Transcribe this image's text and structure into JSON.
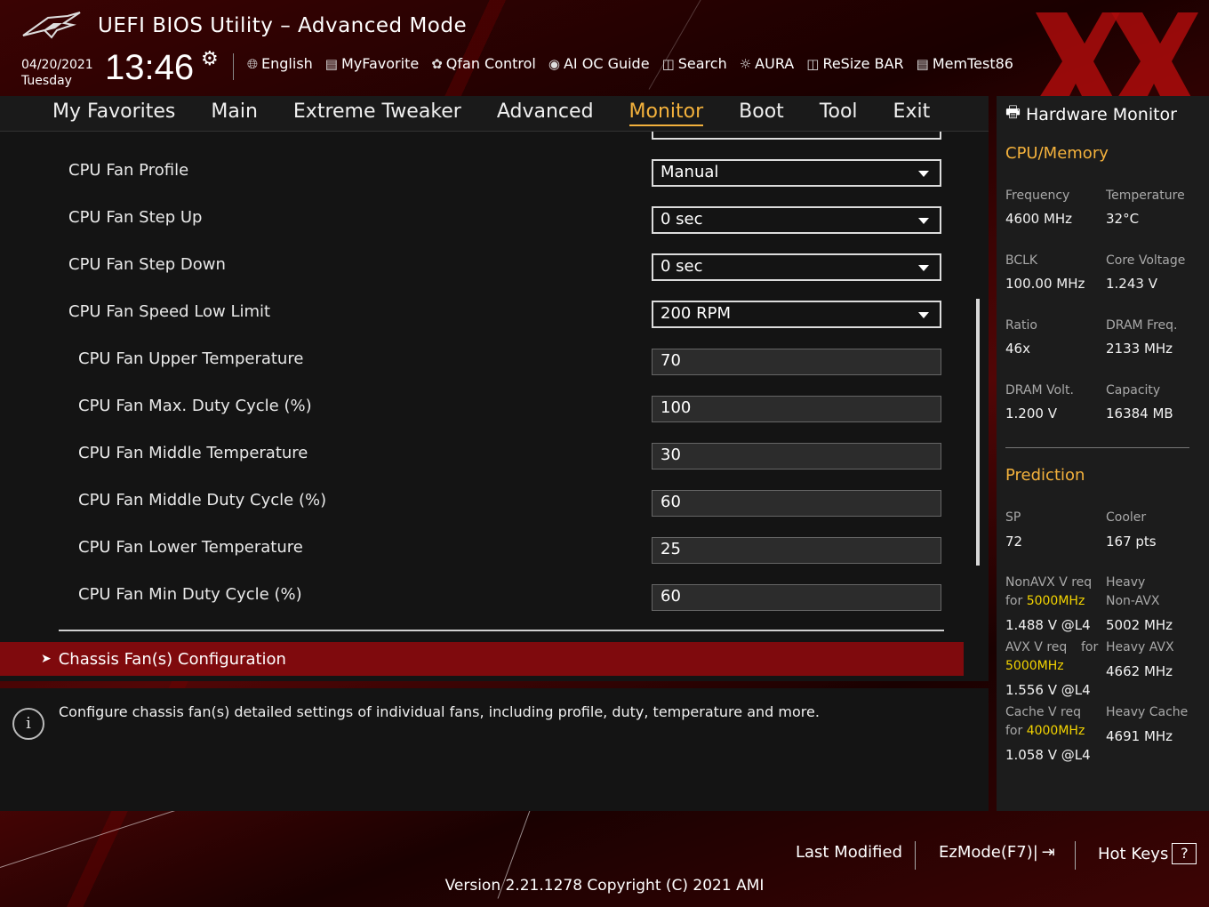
{
  "header": {
    "title": "UEFI BIOS Utility – Advanced Mode",
    "date": "04/20/2021",
    "day": "Tuesday",
    "time": "13:46",
    "tools": [
      {
        "label": "English",
        "icon": "globe-icon"
      },
      {
        "label": "MyFavorite",
        "icon": "favorite-icon"
      },
      {
        "label": "Qfan Control",
        "icon": "fan-icon"
      },
      {
        "label": "AI OC Guide",
        "icon": "ai-oc-icon"
      },
      {
        "label": "Search",
        "icon": "search-icon"
      },
      {
        "label": "AURA",
        "icon": "aura-icon"
      },
      {
        "label": "ReSize BAR",
        "icon": "resize-bar-icon"
      },
      {
        "label": "MemTest86",
        "icon": "memtest-icon"
      }
    ]
  },
  "tabs": [
    {
      "label": "My Favorites"
    },
    {
      "label": "Main"
    },
    {
      "label": "Extreme Tweaker"
    },
    {
      "label": "Advanced"
    },
    {
      "label": "Monitor",
      "active": true
    },
    {
      "label": "Boot"
    },
    {
      "label": "Tool"
    },
    {
      "label": "Exit"
    }
  ],
  "settings": [
    {
      "label": "CPU Fan Profile",
      "value": "Manual",
      "type": "dropdown"
    },
    {
      "label": "CPU Fan Step Up",
      "value": "0 sec",
      "type": "dropdown"
    },
    {
      "label": "CPU Fan Step Down",
      "value": "0 sec",
      "type": "dropdown"
    },
    {
      "label": "CPU Fan Speed Low Limit",
      "value": "200 RPM",
      "type": "dropdown"
    },
    {
      "label": "CPU Fan Upper Temperature",
      "value": "70",
      "type": "field"
    },
    {
      "label": "CPU Fan Max. Duty Cycle (%)",
      "value": "100",
      "type": "field"
    },
    {
      "label": "CPU Fan Middle Temperature",
      "value": "30",
      "type": "field"
    },
    {
      "label": "CPU Fan Middle Duty Cycle (%)",
      "value": "60",
      "type": "field"
    },
    {
      "label": "CPU Fan Lower Temperature",
      "value": "25",
      "type": "field"
    },
    {
      "label": "CPU Fan Min Duty Cycle (%)",
      "value": "60",
      "type": "field"
    }
  ],
  "submenu": {
    "label": "Chassis Fan(s) Configuration"
  },
  "help": {
    "text": "Configure chassis fan(s) detailed settings of individual fans, including profile, duty, temperature and more."
  },
  "hw_monitor": {
    "title": "Hardware Monitor",
    "cpu_memory": {
      "title": "CPU/Memory",
      "frequency_label": "Frequency",
      "frequency": "4600 MHz",
      "temperature_label": "Temperature",
      "temperature": "32°C",
      "bclk_label": "BCLK",
      "bclk": "100.00 MHz",
      "core_voltage_label": "Core Voltage",
      "core_voltage": "1.243 V",
      "ratio_label": "Ratio",
      "ratio": "46x",
      "dram_freq_label": "DRAM Freq.",
      "dram_freq": "2133 MHz",
      "dram_volt_label": "DRAM Volt.",
      "dram_volt": "1.200 V",
      "capacity_label": "Capacity",
      "capacity": "16384 MB"
    },
    "prediction": {
      "title": "Prediction",
      "sp_label": "SP",
      "sp": "72",
      "cooler_label": "Cooler",
      "cooler": "167 pts",
      "nonavx_label_1": "NonAVX V req",
      "nonavx_label_2": "for ",
      "nonavx_freq": "5000MHz",
      "nonavx_val": "1.488 V @L4",
      "heavy_nonavx_label_1": "Heavy",
      "heavy_nonavx_label_2": "Non-AVX",
      "heavy_nonavx_val": "5002 MHz",
      "avx_label_1": "AVX V req",
      "avx_label_for": "for",
      "avx_freq": "5000MHz",
      "avx_val": "1.556 V @L4",
      "heavy_avx_label": "Heavy AVX",
      "heavy_avx_val": "4662 MHz",
      "cache_label_1": "Cache V req",
      "cache_label_2": "for ",
      "cache_freq": "4000MHz",
      "cache_val": "1.058 V @L4",
      "heavy_cache_label": "Heavy Cache",
      "heavy_cache_val": "4691 MHz"
    }
  },
  "footer": {
    "last_modified": "Last Modified",
    "ezmode": "EzMode(F7)|",
    "hotkeys": "Hot Keys",
    "hotkeys_key": "?",
    "version": "Version 2.21.1278 Copyright (C) 2021 AMI"
  },
  "colors": {
    "accent": "#f3b13c",
    "highlight": "#f3d400",
    "selection": "#7f0a0d"
  }
}
